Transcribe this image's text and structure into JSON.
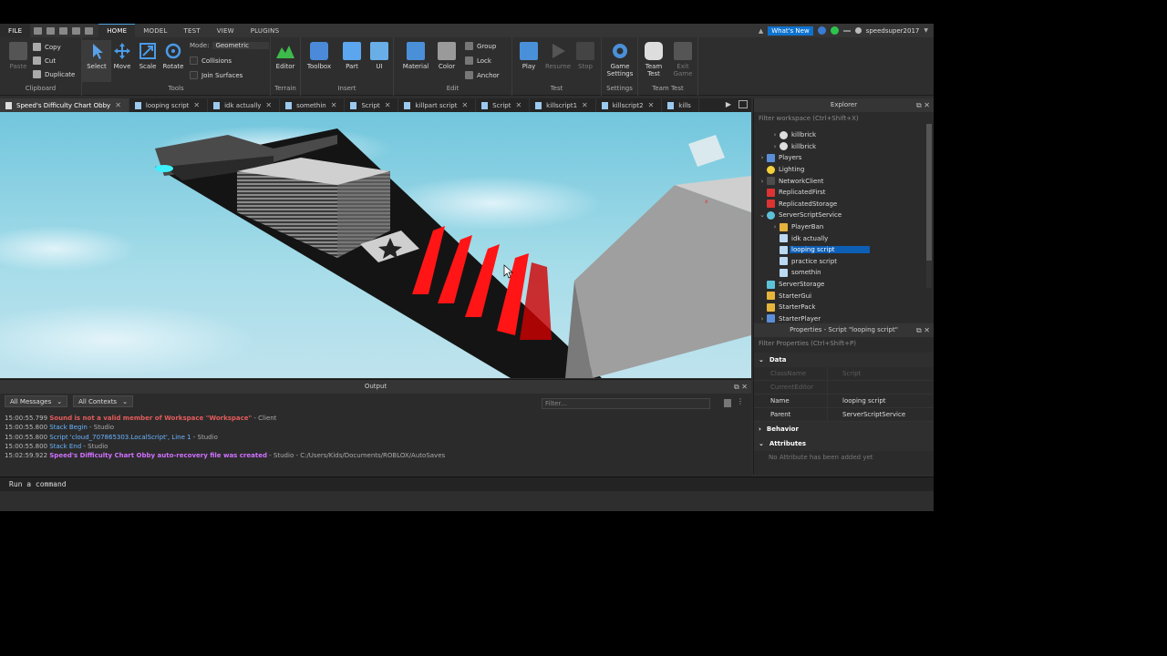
{
  "menu": {
    "tabs": [
      "FILE",
      "HOME",
      "MODEL",
      "TEST",
      "VIEW",
      "PLUGINS"
    ],
    "active_tab": "HOME",
    "whats_new": "What's New",
    "username": "speedsuper2017"
  },
  "ribbon": {
    "clipboard": {
      "paste": "Paste",
      "copy": "Copy",
      "cut": "Cut",
      "duplicate": "Duplicate",
      "label": "Clipboard"
    },
    "tools": {
      "select": "Select",
      "move": "Move",
      "scale": "Scale",
      "rotate": "Rotate",
      "mode_label": "Mode:",
      "mode_value": "Geometric",
      "collisions": "Collisions",
      "join_surfaces": "Join Surfaces",
      "label": "Tools"
    },
    "terrain": {
      "editor": "Editor",
      "label": "Terrain"
    },
    "insert": {
      "toolbox": "Toolbox",
      "part": "Part",
      "ui": "UI",
      "label": "Insert"
    },
    "edit": {
      "material": "Material",
      "color": "Color",
      "group": "Group",
      "lock": "Lock",
      "anchor": "Anchor",
      "label": "Edit"
    },
    "test": {
      "play": "Play",
      "resume": "Resume",
      "stop": "Stop",
      "label": "Test"
    },
    "settings": {
      "game_settings": "Game Settings",
      "label": "Settings"
    },
    "team_test": {
      "team_test": "Team Test",
      "exit_game": "Exit Game",
      "label": "Team Test"
    }
  },
  "doc_tabs": [
    "Speed's Difficulty Chart Obby",
    "looping script",
    "idk actually",
    "somethin",
    "Script",
    "killpart script",
    "Script",
    "killscript1",
    "killscript2",
    "kills"
  ],
  "output": {
    "title": "Output",
    "messages_filter": "All Messages",
    "contexts_filter": "All Contexts",
    "filter_placeholder": "Filter...",
    "lines": [
      {
        "ts": "15:00:55.799",
        "msg": "Sound is not a valid member of Workspace \"Workspace\"",
        "src": " - Client"
      },
      {
        "ts": "15:00:55.800",
        "msg": "Stack Begin",
        "src": " - Studio"
      },
      {
        "ts": "15:00:55.800",
        "msg": "Script 'cloud_707865303.LocalScript', Line 1",
        "src": " - Studio"
      },
      {
        "ts": "15:00:55.800",
        "msg": "Stack End",
        "src": " - Studio"
      },
      {
        "ts": "15:02:59.922",
        "msg": "Speed's Difficulty Chart Obby auto-recovery file was created",
        "src": " - Studio - C:/Users/Kids/Documents/ROBLOX/AutoSaves"
      }
    ]
  },
  "command_bar": {
    "placeholder": "Run a command"
  },
  "explorer": {
    "title": "Explorer",
    "filter_placeholder": "Filter workspace (Ctrl+Shift+X)",
    "nodes": [
      "killbrick",
      "killbrick",
      "Players",
      "Lighting",
      "NetworkClient",
      "ReplicatedFirst",
      "ReplicatedStorage",
      "ServerScriptService",
      "PlayerBan",
      "idk actually",
      "looping script",
      "practice script",
      "somethin",
      "ServerStorage",
      "StarterGui",
      "StarterPack",
      "StarterPlayer"
    ],
    "selected": "looping script"
  },
  "properties": {
    "title": "Properties - Script \"looping script\"",
    "filter_placeholder": "Filter Properties (Ctrl+Shift+P)",
    "sections": {
      "data": "Data",
      "behavior": "Behavior",
      "attributes": "Attributes"
    },
    "rows": [
      {
        "k": "ClassName",
        "v": "Script"
      },
      {
        "k": "CurrentEditor",
        "v": ""
      },
      {
        "k": "Name",
        "v": "looping script"
      },
      {
        "k": "Parent",
        "v": "ServerScriptService"
      }
    ],
    "no_attributes": "No Attribute has been added yet"
  },
  "colors": {
    "accent": "#0d5eb5",
    "killbrick_red": "#ff1010",
    "sky": "#7fcde0"
  }
}
